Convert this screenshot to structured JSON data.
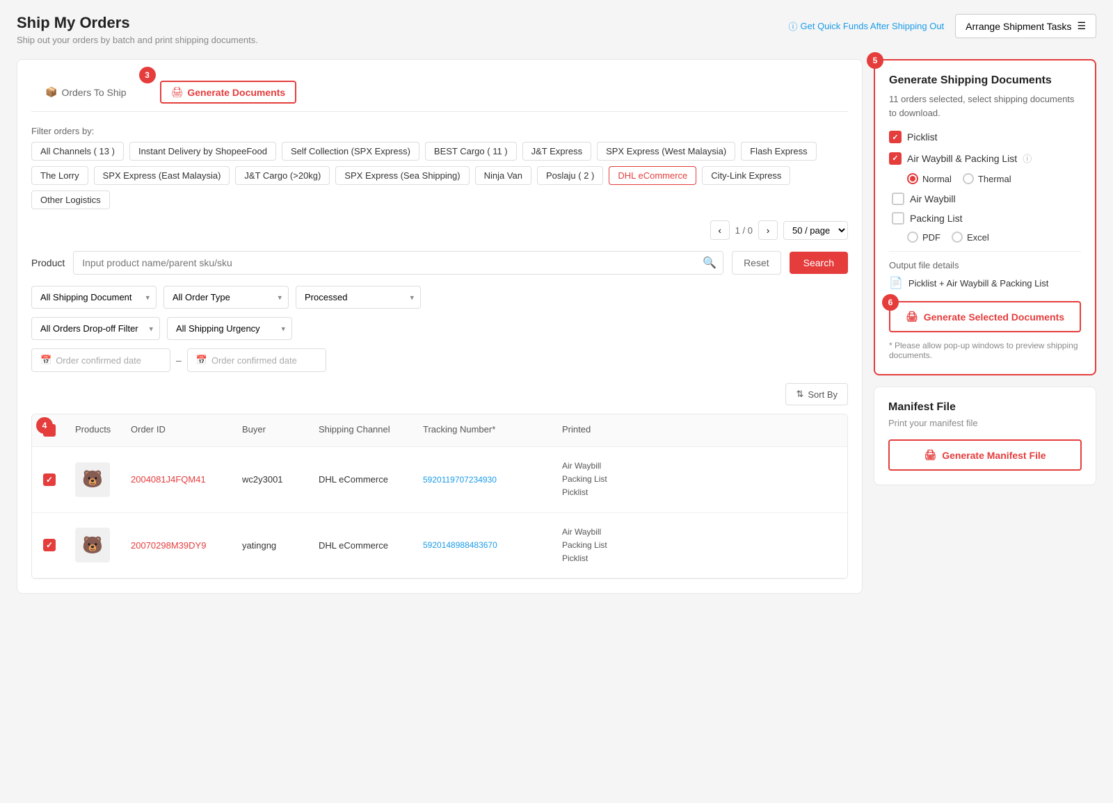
{
  "page": {
    "title": "Ship My Orders",
    "subtitle": "Ship out your orders by batch and print shipping documents.",
    "quick_fund_label": "Get Quick Funds After Shipping Out",
    "arrange_btn_label": "Arrange Shipment Tasks"
  },
  "tabs": {
    "orders_to_ship": "Orders To Ship",
    "generate_documents": "Generate Documents"
  },
  "filters": {
    "label": "Filter orders by:",
    "tags": [
      {
        "label": "All Channels ( 13 )",
        "active": false
      },
      {
        "label": "Instant Delivery by ShopeeFood",
        "active": false
      },
      {
        "label": "Self Collection (SPX Express)",
        "active": false
      },
      {
        "label": "BEST Cargo ( 11 )",
        "active": false
      },
      {
        "label": "J&T Express",
        "active": false
      },
      {
        "label": "SPX Express (West Malaysia)",
        "active": false
      },
      {
        "label": "Flash Express",
        "active": false
      },
      {
        "label": "The Lorry",
        "active": false
      },
      {
        "label": "SPX Express (East Malaysia)",
        "active": false
      },
      {
        "label": "J&T Cargo (>20kg)",
        "active": false
      },
      {
        "label": "SPX Express (Sea Shipping)",
        "active": false
      },
      {
        "label": "Ninja Van",
        "active": false
      },
      {
        "label": "Poslaju ( 2 )",
        "active": false
      },
      {
        "label": "DHL eCommerce",
        "active": true
      },
      {
        "label": "City-Link Express",
        "active": false
      },
      {
        "label": "Other Logistics",
        "active": false
      }
    ]
  },
  "pagination": {
    "current": "1",
    "total": "0",
    "per_page": "50 / page"
  },
  "search": {
    "label": "Product",
    "placeholder": "Input product name/parent sku/sku",
    "reset_label": "Reset",
    "search_label": "Search"
  },
  "dropdowns": {
    "shipping_document": "All Shipping Document",
    "order_type": "All Order Type",
    "processed": "Processed",
    "drop_off": "All Orders Drop-off Filter",
    "urgency": "All Shipping Urgency"
  },
  "date_inputs": {
    "start_placeholder": "Order confirmed date",
    "end_placeholder": "Order confirmed date"
  },
  "sort_btn": "Sort By",
  "table": {
    "headers": [
      "",
      "Products",
      "Order ID",
      "Buyer",
      "Shipping Channel",
      "Tracking Number*",
      "Printed"
    ],
    "rows": [
      {
        "order_id": "2004081J4FQM41",
        "buyer": "wc2y3001",
        "channel": "DHL eCommerce",
        "tracking": "5920119707234930",
        "printed": "Air Waybill\nPacking List\nPicklist",
        "product_emoji": "🐻"
      },
      {
        "order_id": "20070298M39DY9",
        "buyer": "yatingng",
        "channel": "DHL eCommerce",
        "tracking": "5920148988483670",
        "printed": "Air Waybill\nPacking List\nPicklist",
        "product_emoji": "🐻"
      }
    ]
  },
  "right_panel": {
    "gen_doc": {
      "title": "Generate Shipping Documents",
      "subtitle": "11 orders selected, select shipping documents to download.",
      "options": [
        {
          "label": "Picklist",
          "checked": true
        },
        {
          "label": "Air Waybill & Packing List",
          "checked": true
        }
      ],
      "radio_normal": "Normal",
      "radio_thermal": "Thermal",
      "sub_options": [
        {
          "label": "Air Waybill",
          "checked": false
        },
        {
          "label": "Packing List",
          "checked": false
        }
      ],
      "pdf_label": "PDF",
      "excel_label": "Excel",
      "output_label": "Output file details",
      "output_file": "Picklist + Air Waybill & Packing List",
      "gen_btn_label": "Generate Selected Documents",
      "popup_note": "* Please allow pop-up windows to preview shipping documents."
    },
    "manifest": {
      "title": "Manifest File",
      "subtitle": "Print your manifest file",
      "btn_label": "Generate Manifest File"
    }
  },
  "badges": {
    "tab3": "3",
    "tab4": "4",
    "tab5": "5",
    "tab6": "6"
  },
  "icons": {
    "orders_icon": "📦",
    "doc_icon": "🖨",
    "pdf_icon": "📄",
    "print_icon": "🖨"
  }
}
